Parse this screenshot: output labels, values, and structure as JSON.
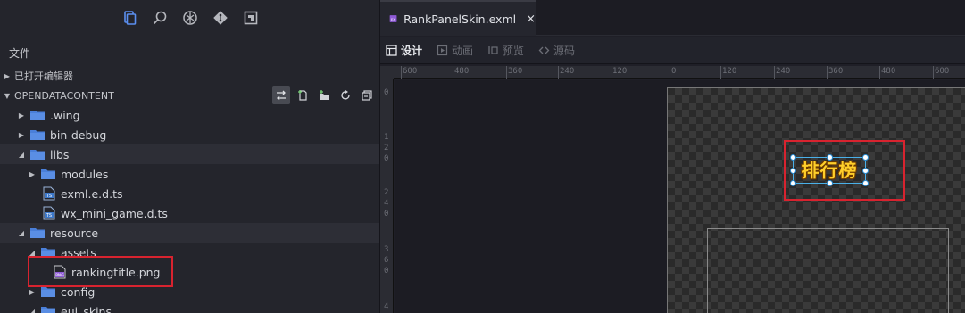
{
  "activity_icons": [
    "files-icon",
    "search-icon",
    "debug-icon",
    "git-icon",
    "extensions-icon"
  ],
  "explorer": {
    "title": "文件",
    "open_editors_label": "已打开编辑器",
    "project_label": "OPENDATACONTENT",
    "toolbar_icons": [
      "toggle-icon",
      "new-file-icon",
      "new-folder-icon",
      "refresh-icon",
      "collapse-icon"
    ]
  },
  "tree": [
    {
      "label": ".wing",
      "type": "folder",
      "depth": 1,
      "expanded": false
    },
    {
      "label": "bin-debug",
      "type": "folder",
      "depth": 1,
      "expanded": false
    },
    {
      "label": "libs",
      "type": "folder",
      "depth": 1,
      "expanded": true
    },
    {
      "label": "modules",
      "type": "folder",
      "depth": 2,
      "expanded": false
    },
    {
      "label": "exml.e.d.ts",
      "type": "ts",
      "depth": 2
    },
    {
      "label": "wx_mini_game.d.ts",
      "type": "ts",
      "depth": 2
    },
    {
      "label": "resource",
      "type": "folder",
      "depth": 1,
      "expanded": true
    },
    {
      "label": "assets",
      "type": "folder",
      "depth": 2,
      "expanded": true
    },
    {
      "label": "rankingtitle.png",
      "type": "png",
      "depth": 3
    },
    {
      "label": "config",
      "type": "folder",
      "depth": 2,
      "expanded": false
    },
    {
      "label": "eui_skins",
      "type": "folder",
      "depth": 2,
      "expanded": true
    }
  ],
  "editor": {
    "tab_label": "RankPanelSkin.exml",
    "tab_close": "×",
    "modes": [
      {
        "label": "设计",
        "active": true
      },
      {
        "label": "动画",
        "active": false
      },
      {
        "label": "预览",
        "active": false
      },
      {
        "label": "源码",
        "active": false
      }
    ],
    "ruler_h_labels": [
      "600",
      "480",
      "360",
      "240",
      "120",
      "0",
      "120",
      "240",
      "360",
      "480",
      "600"
    ],
    "ruler_v_labels": [
      "0",
      "1",
      "2",
      "0",
      "2",
      "4",
      "0",
      "3",
      "6",
      "0",
      "4"
    ],
    "title_image_text": "排行榜"
  },
  "colors": {
    "highlight_red": "#d8232f",
    "folder_blue": "#4a7fd9",
    "selection_blue": "#4ab0e8",
    "title_gold": "#ffcf2a"
  }
}
